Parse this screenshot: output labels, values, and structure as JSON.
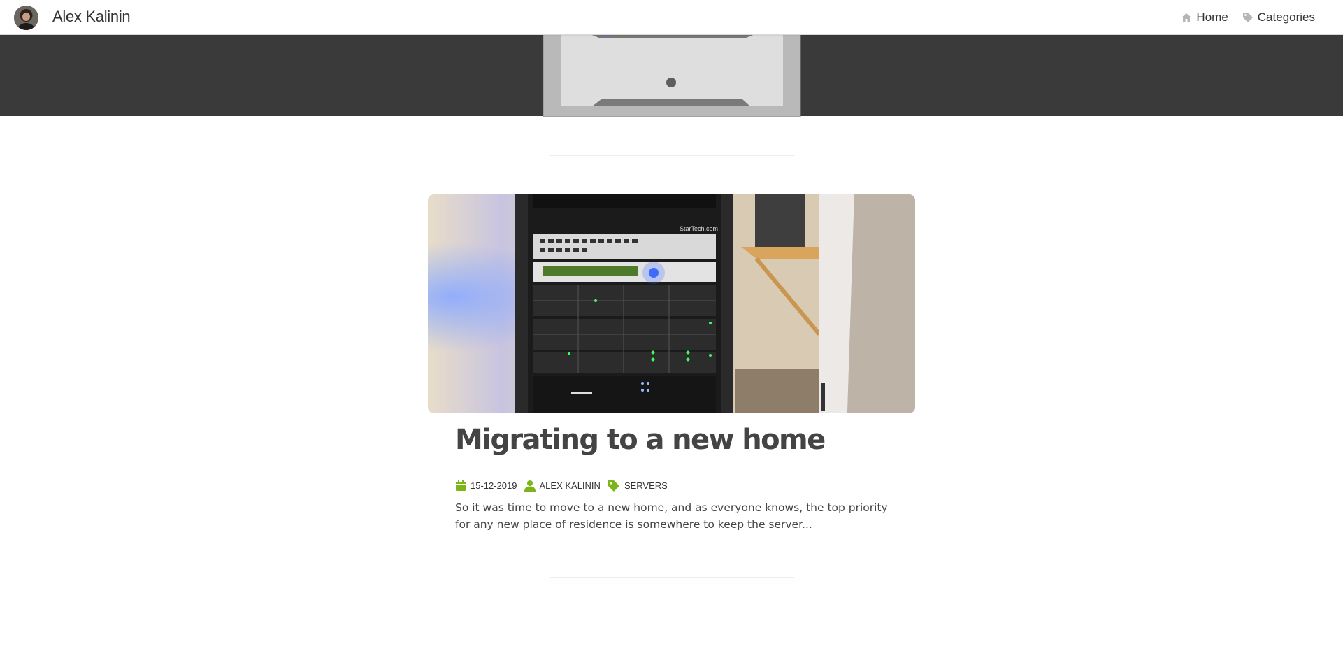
{
  "navbar": {
    "brand": "Alex Kalinin",
    "links": [
      {
        "label": "Home",
        "icon": "home-icon"
      },
      {
        "label": "Categories",
        "icon": "tag-icon"
      }
    ]
  },
  "post": {
    "title": "Migrating to a new home",
    "date": "15-12-2019",
    "author": "ALEX KALININ",
    "category": "SERVERS",
    "excerpt": "So it was time to move to a new home, and as everyone knows, the top priority for any new place of residence is somewhere to keep the server...",
    "image_caption_brand": "StarTech.com"
  },
  "colors": {
    "accent": "#7cb518",
    "hero_bg": "#3a3a3a",
    "text": "#333333"
  }
}
